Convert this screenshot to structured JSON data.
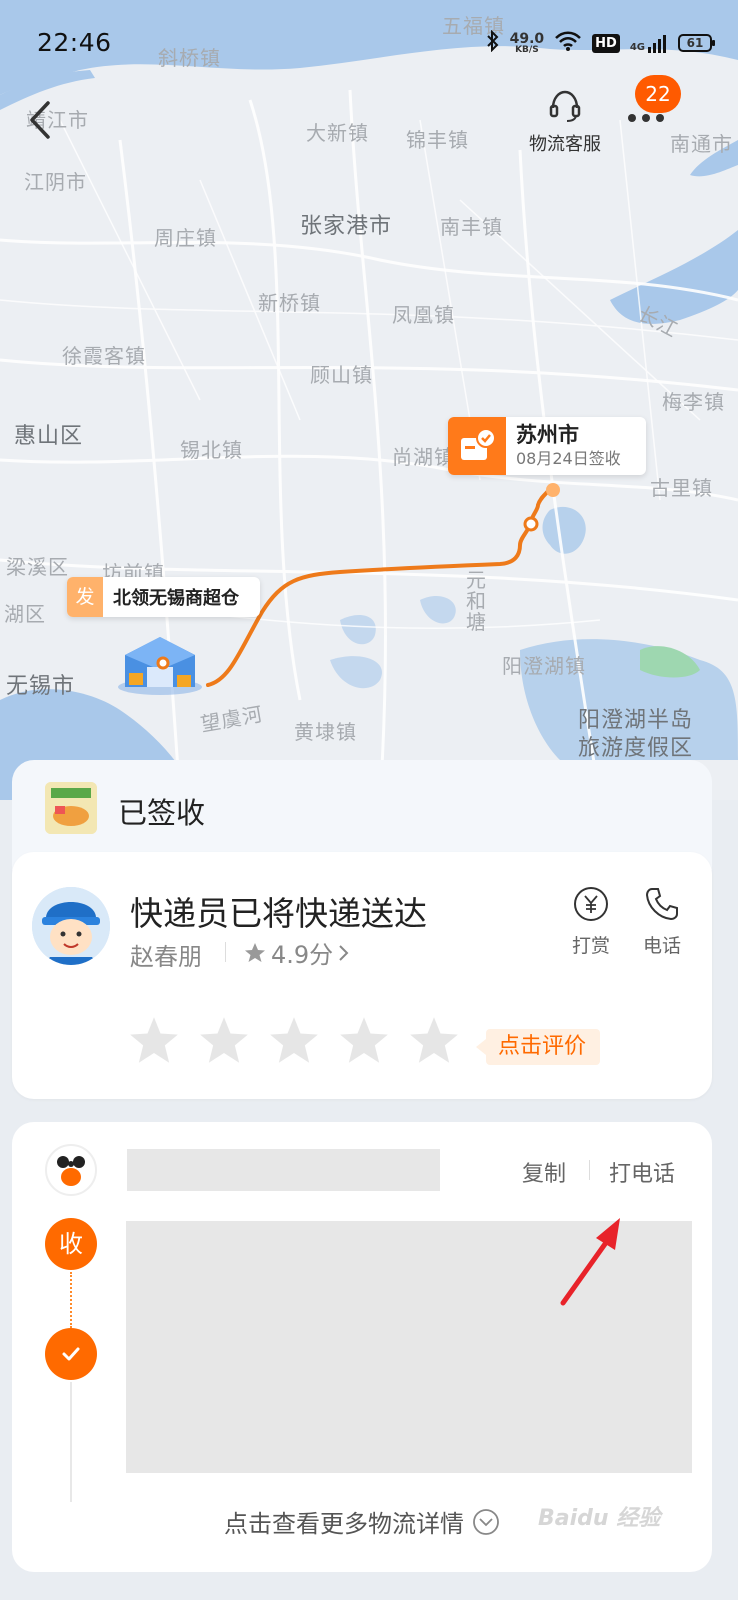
{
  "status_bar": {
    "time": "22:46",
    "net_speed_value": "49.0",
    "net_speed_unit": "KB/S",
    "hd_label": "HD",
    "signal_label": "4G",
    "battery": "61"
  },
  "top_bar": {
    "service_label": "物流客服",
    "notification_count": "22"
  },
  "map": {
    "labels": [
      "斜桥镇",
      "五福镇",
      "靖江市",
      "大新镇",
      "锦丰镇",
      "南通市",
      "江阴市",
      "张家港市",
      "南丰镇",
      "周庄镇",
      "新桥镇",
      "凤凰镇",
      "长江",
      "徐霞客镇",
      "顾山镇",
      "梅李镇",
      "惠山区",
      "锡北镇",
      "尚湖镇",
      "古里镇",
      "梁溪区",
      "坊前镇",
      "湖区",
      "无锡市",
      "元和塘",
      "阳澄湖镇",
      "阳澄湖半岛",
      "旅游度假区",
      "望虞河",
      "黄埭镇"
    ],
    "destination": {
      "city": "苏州市",
      "date": "08月24日签收"
    },
    "origin": {
      "tag": "发",
      "name": "北领无锡商超仓"
    }
  },
  "sheet": {
    "status": "已签收",
    "courier": {
      "title": "快递员已将快递送达",
      "name": "赵春朋",
      "rating": "4.9分",
      "tip_label": "打赏",
      "call_label": "电话",
      "rate_button": "点击评价",
      "star_count": 5
    },
    "address": {
      "copy_label": "复制",
      "call_label": "打电话",
      "receive_label": "收",
      "more_details": "点击查看更多物流详情"
    }
  },
  "watermark": "Baidu 经验",
  "colors": {
    "accent": "#ff6a00",
    "route": "#ee7a1a",
    "badge": "#ff5a00",
    "arrow": "#e8232a"
  }
}
